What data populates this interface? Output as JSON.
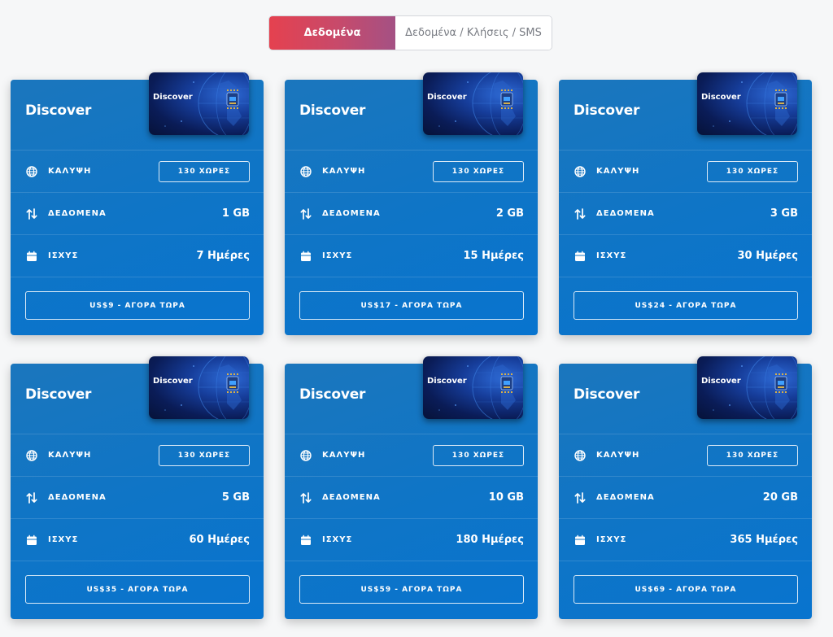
{
  "tabs": [
    {
      "label": "Δεδομένα",
      "active": true
    },
    {
      "label": "Δεδομένα / Κλήσεις / SMS",
      "active": false
    }
  ],
  "colors": {
    "tab_active_start": "#e5414f",
    "tab_active_end": "#a45184",
    "card_blue": "#0f75c6"
  },
  "row_labels": {
    "coverage": "ΚΑΛΥΨΗ",
    "data": "ΔΕΔΟΜΕΝΑ",
    "validity": "ΙΣΧΥΣ"
  },
  "icons": {
    "coverage": "globe-icon",
    "data": "arrows-up-down-icon",
    "validity": "calendar-icon"
  },
  "plans": [
    {
      "title": "Discover",
      "sim_label": "Discover",
      "coverage": "130 ΧΩΡΕΣ",
      "data": "1 GB",
      "validity": "7 Ημέρες",
      "buy": "US$9 - ΑΓΟΡΑ ΤΩΡΑ"
    },
    {
      "title": "Discover",
      "sim_label": "Discover",
      "coverage": "130 ΧΩΡΕΣ",
      "data": "2 GB",
      "validity": "15 Ημέρες",
      "buy": "US$17 - ΑΓΟΡΑ ΤΩΡΑ"
    },
    {
      "title": "Discover",
      "sim_label": "Discover",
      "coverage": "130 ΧΩΡΕΣ",
      "data": "3 GB",
      "validity": "30 Ημέρες",
      "buy": "US$24 - ΑΓΟΡΑ ΤΩΡΑ"
    },
    {
      "title": "Discover",
      "sim_label": "Discover",
      "coverage": "130 ΧΩΡΕΣ",
      "data": "5 GB",
      "validity": "60 Ημέρες",
      "buy": "US$35 - ΑΓΟΡΑ ΤΩΡΑ"
    },
    {
      "title": "Discover",
      "sim_label": "Discover",
      "coverage": "130 ΧΩΡΕΣ",
      "data": "10 GB",
      "validity": "180 Ημέρες",
      "buy": "US$59 - ΑΓΟΡΑ ΤΩΡΑ"
    },
    {
      "title": "Discover",
      "sim_label": "Discover",
      "coverage": "130 ΧΩΡΕΣ",
      "data": "20 GB",
      "validity": "365 Ημέρες",
      "buy": "US$69 - ΑΓΟΡΑ ΤΩΡΑ"
    }
  ]
}
